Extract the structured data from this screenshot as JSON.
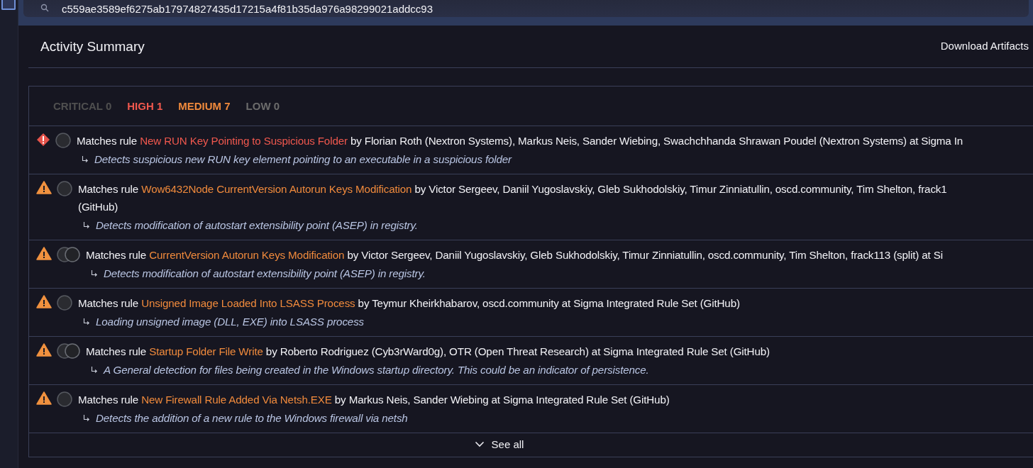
{
  "search": {
    "value": "c559ae3589ef6275ab17974827435d17215a4f81b35da976a98299021addcc93"
  },
  "header": {
    "title": "Activity Summary",
    "action": "Download Artifacts"
  },
  "severity_tabs": [
    {
      "kind": "critical",
      "label": "CRITICAL",
      "count": "0",
      "disabled": true
    },
    {
      "kind": "high",
      "label": "HIGH",
      "count": "1",
      "disabled": false
    },
    {
      "kind": "medium",
      "label": "MEDIUM",
      "count": "7",
      "disabled": false
    },
    {
      "kind": "low",
      "label": "LOW",
      "count": "0",
      "disabled": true
    }
  ],
  "matches": [
    {
      "kind": "high",
      "double_avatar": false,
      "prefix": "Matches rule",
      "rule": "New RUN Key Pointing to Suspicious Folder",
      "authors": "by Florian Roth (Nextron Systems), Markus Neis, Sander Wiebing, Swachchhanda Shrawan Poudel (Nextron Systems) at Sigma In",
      "description": "Detects suspicious new RUN key element pointing to an executable in a suspicious folder"
    },
    {
      "kind": "medium",
      "double_avatar": false,
      "prefix": "Matches rule",
      "rule": "Wow6432Node CurrentVersion Autorun Keys Modification",
      "authors": "by Victor Sergeev, Daniil Yugoslavskiy, Gleb Sukhodolskiy, Timur Zinniatullin, oscd.community, Tim Shelton, frack1",
      "continued": "(GitHub)",
      "description": "Detects modification of autostart extensibility point (ASEP) in registry."
    },
    {
      "kind": "medium",
      "double_avatar": true,
      "prefix": "Matches rule",
      "rule": "CurrentVersion Autorun Keys Modification",
      "authors": "by Victor Sergeev, Daniil Yugoslavskiy, Gleb Sukhodolskiy, Timur Zinniatullin, oscd.community, Tim Shelton, frack113 (split) at Si",
      "description": "Detects modification of autostart extensibility point (ASEP) in registry."
    },
    {
      "kind": "medium",
      "double_avatar": false,
      "prefix": "Matches rule",
      "rule": "Unsigned Image Loaded Into LSASS Process",
      "authors": "by Teymur Kheirkhabarov, oscd.community at Sigma Integrated Rule Set (GitHub)",
      "description": "Loading unsigned image (DLL, EXE) into LSASS process"
    },
    {
      "kind": "medium",
      "double_avatar": true,
      "prefix": "Matches rule",
      "rule": "Startup Folder File Write",
      "authors": "by Roberto Rodriguez (Cyb3rWard0g), OTR (Open Threat Research) at Sigma Integrated Rule Set (GitHub)",
      "description": "A General detection for files being created in the Windows startup directory. This could be an indicator of persistence."
    },
    {
      "kind": "medium",
      "double_avatar": false,
      "prefix": "Matches rule",
      "rule": "New Firewall Rule Added Via Netsh.EXE",
      "authors": "by Markus Neis, Sander Wiebing at Sigma Integrated Rule Set (GitHub)",
      "description": "Detects the addition of a new rule to the Windows firewall via netsh"
    }
  ],
  "see_all": "See all"
}
